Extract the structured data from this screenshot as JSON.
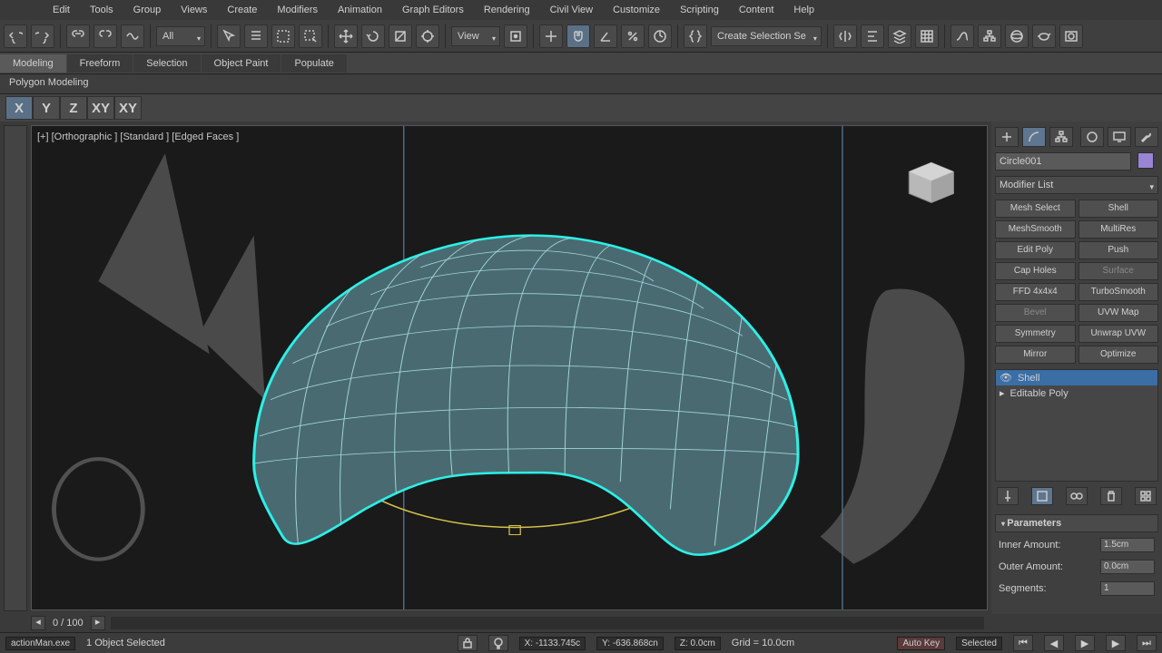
{
  "menus": [
    "Edit",
    "Tools",
    "Group",
    "Views",
    "Create",
    "Modifiers",
    "Animation",
    "Graph Editors",
    "Rendering",
    "Civil View",
    "Customize",
    "Scripting",
    "Content",
    "Help"
  ],
  "toolbar": {
    "combo1": "All",
    "combo2": "View",
    "combo3": "Create Selection Se"
  },
  "ribbon": {
    "tabs": [
      "Modeling",
      "Freeform",
      "Selection",
      "Object Paint",
      "Populate"
    ],
    "active": 0,
    "group": "Polygon Modeling"
  },
  "axis": [
    "X",
    "Y",
    "Z",
    "XY",
    "XY"
  ],
  "viewport": {
    "label": "[+] [Orthographic ] [Standard ] [Edged Faces ]"
  },
  "cmd": {
    "object_name": "Circle001",
    "modifier_list": "Modifier List",
    "mod_buttons": [
      [
        "Mesh Select",
        "Shell"
      ],
      [
        "MeshSmooth",
        "MultiRes"
      ],
      [
        "Edit Poly",
        "Push"
      ],
      [
        "Cap Holes",
        "Surface"
      ],
      [
        "FFD 4x4x4",
        "TurboSmooth"
      ],
      [
        "Bevel",
        "UVW Map"
      ],
      [
        "Symmetry",
        "Unwrap UVW"
      ],
      [
        "Mirror",
        "Optimize"
      ]
    ],
    "mod_dim": [
      "Surface",
      "Bevel"
    ],
    "stack": [
      {
        "name": "Shell",
        "sel": true,
        "eye": true,
        "exp": false
      },
      {
        "name": "Editable Poly",
        "sel": false,
        "eye": false,
        "exp": true
      }
    ],
    "rollout": "Parameters",
    "params": [
      {
        "label": "Inner Amount:",
        "value": "1.5cm"
      },
      {
        "label": "Outer Amount:",
        "value": "0.0cm"
      },
      {
        "label": "Segments:",
        "value": "1"
      }
    ]
  },
  "time": {
    "frame": "0 / 100"
  },
  "status": {
    "script": "actionMan.exe",
    "sel": "1 Object Selected",
    "x": "X: -1133.745c",
    "y": "Y: -636.868cn",
    "z": "Z: 0.0cm",
    "grid": "Grid = 10.0cm",
    "autokey": "Auto Key",
    "keymode": "Selected"
  }
}
